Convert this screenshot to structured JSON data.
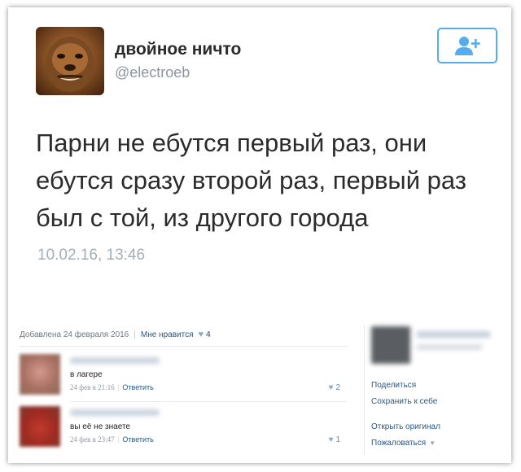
{
  "tweet": {
    "display_name": "двойное ничто",
    "handle": "@electroeb",
    "text": "Парни не ебутся первый раз, они ебутся сразу второй раз, первый раз был с той, из другого города",
    "timestamp": "10.02.16, 13:46",
    "avatar_icon": "chewbacca-avatar",
    "follow_icon": "add-user-icon",
    "accent_color": "#55acee"
  },
  "post": {
    "added_text": "Добавлена 24 февраля 2016",
    "likes_label": "Мне нравится",
    "likes_count": "4"
  },
  "comments": [
    {
      "text": "в лагере",
      "date": "24 фев в 21:16",
      "reply_label": "Ответить",
      "likes": "2"
    },
    {
      "text": "вы её не знаете",
      "date": "24 фев в 23:47",
      "reply_label": "Ответить",
      "likes": "1"
    }
  ],
  "sidebar": {
    "share": "Поделиться",
    "save": "Сохранить к себе",
    "open_original": "Открыть оригинал",
    "report": "Пожаловаться"
  }
}
